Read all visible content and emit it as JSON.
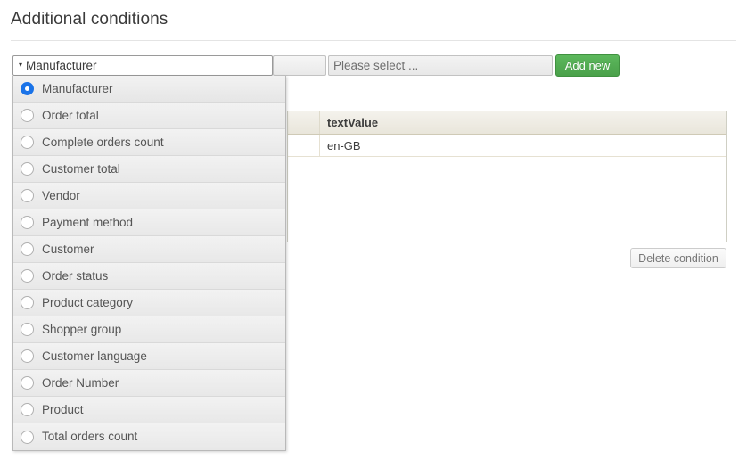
{
  "page": {
    "title": "Additional conditions"
  },
  "toolbar": {
    "condition_select": {
      "value": "Manufacturer",
      "caret": "▾"
    },
    "operator_select": {
      "value": ""
    },
    "value_select": {
      "value": "Please select ..."
    },
    "add_button": {
      "label": "Add new"
    }
  },
  "dropdown": {
    "open": true,
    "selected_index": 0,
    "items": [
      {
        "label": "Manufacturer",
        "selected": true
      },
      {
        "label": "Order total",
        "selected": false
      },
      {
        "label": "Complete orders count",
        "selected": false
      },
      {
        "label": "Customer total",
        "selected": false
      },
      {
        "label": "Vendor",
        "selected": false
      },
      {
        "label": "Payment method",
        "selected": false
      },
      {
        "label": "Customer",
        "selected": false
      },
      {
        "label": "Order status",
        "selected": false
      },
      {
        "label": "Product category",
        "selected": false
      },
      {
        "label": "Shopper group",
        "selected": false
      },
      {
        "label": "Customer language",
        "selected": false
      },
      {
        "label": "Order Number",
        "selected": false
      },
      {
        "label": "Product",
        "selected": false
      },
      {
        "label": "Total orders count",
        "selected": false
      }
    ]
  },
  "table": {
    "columns": [
      "",
      "textValue"
    ],
    "rows": [
      {
        "check": "",
        "textValue": "en-GB"
      }
    ]
  },
  "actions": {
    "delete_condition_label": "Delete condition"
  },
  "colors": {
    "accent_green": "#4aa14a",
    "radio_blue": "#1a73e8",
    "table_header_bg": "#ece9de",
    "text": "#444444"
  }
}
